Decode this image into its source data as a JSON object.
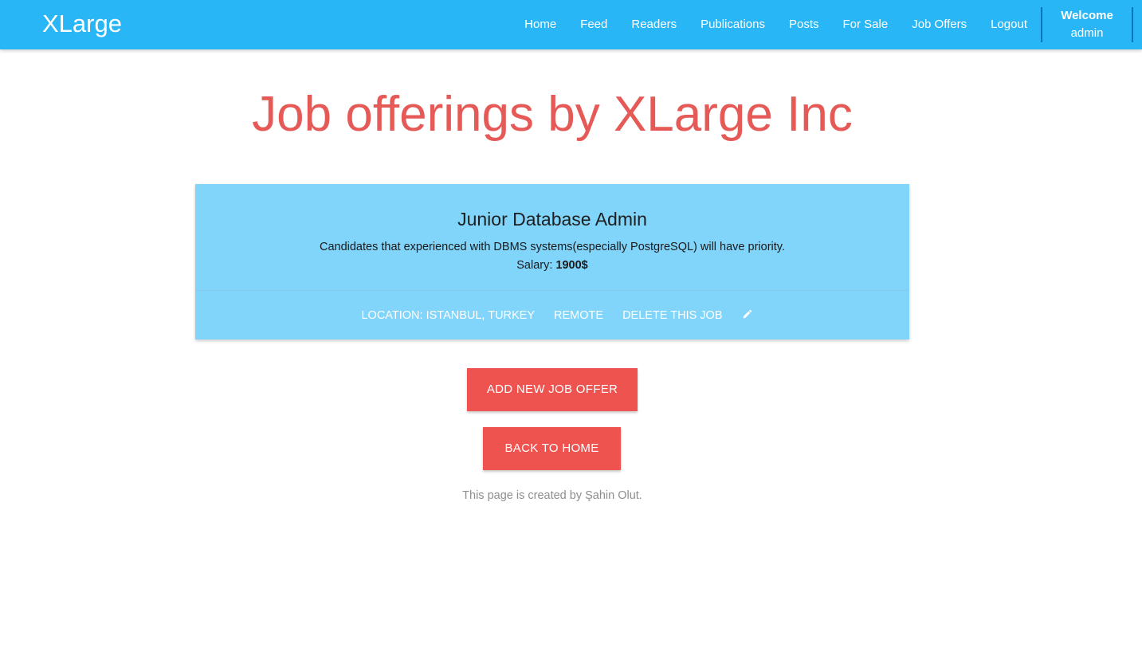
{
  "brand": "XLarge",
  "nav": {
    "items": [
      {
        "label": "Home"
      },
      {
        "label": "Feed"
      },
      {
        "label": "Readers"
      },
      {
        "label": "Publications"
      },
      {
        "label": "Posts"
      },
      {
        "label": "For Sale"
      },
      {
        "label": "Job Offers"
      },
      {
        "label": "Logout"
      }
    ],
    "welcome_label": "Welcome",
    "username": "admin"
  },
  "page": {
    "title": "Job offerings by XLarge Inc"
  },
  "jobs": [
    {
      "title": "Junior Database Admin",
      "description": "Candidates that experienced with DBMS systems(especially PostgreSQL) will have priority.",
      "salary_label": "Salary:",
      "salary_value": "1900$",
      "location": "Location: Istanbul, Turkey",
      "work_type": "Remote",
      "delete_label": "Delete this job",
      "edit_icon": "pencil-icon"
    }
  ],
  "actions": {
    "add_label": "Add new job offer",
    "home_label": "Back to home"
  },
  "footer": {
    "note": "This page is created by Şahin Olut."
  },
  "colors": {
    "navbar": "#29b6f6",
    "card": "#81d4fa",
    "title": "#e55a57",
    "button": "#ef5350"
  }
}
